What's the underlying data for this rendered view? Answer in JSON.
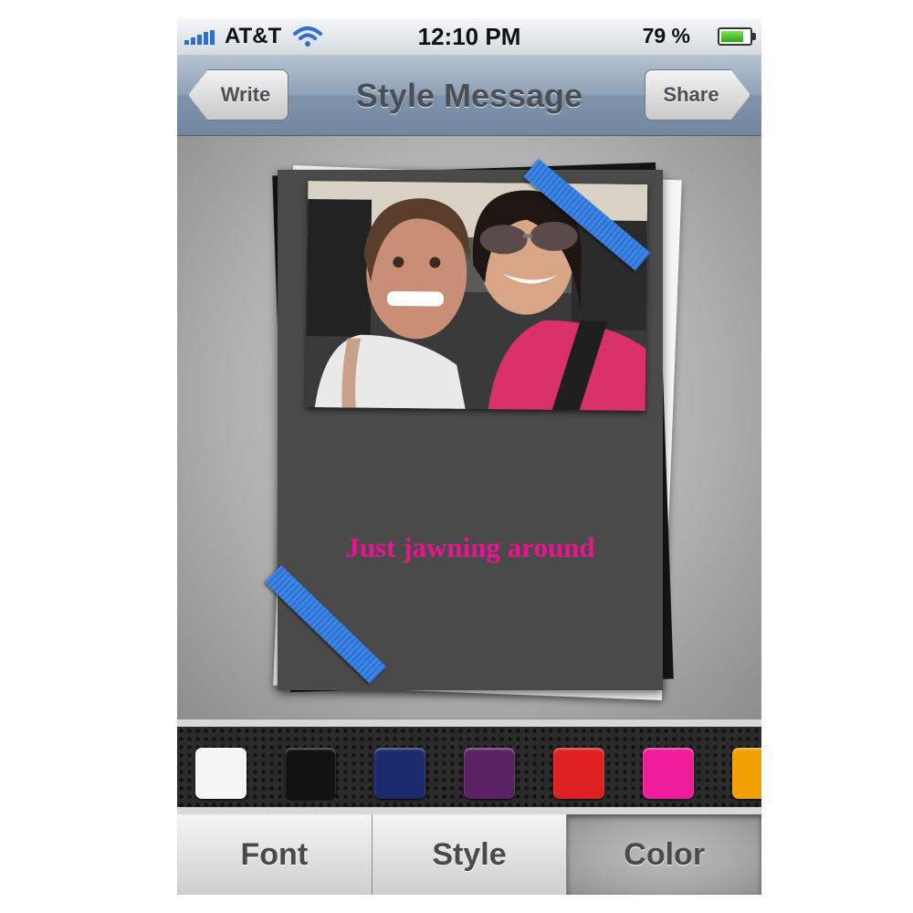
{
  "status_bar": {
    "carrier": "AT&T",
    "time": "12:10 PM",
    "battery_percent": "79 %",
    "battery_level": 0.79,
    "icons": [
      "signal-icon",
      "wifi-icon",
      "battery-icon"
    ]
  },
  "nav": {
    "title": "Style Message",
    "back_label": "Write",
    "share_label": "Share"
  },
  "card": {
    "message": "Just jawning around",
    "message_color": "#e8158f",
    "background_color": "#4a4a4a",
    "ribbon_color": "#3e86e4"
  },
  "colors": [
    {
      "name": "white",
      "hex": "#f5f5f5"
    },
    {
      "name": "black",
      "hex": "#111111"
    },
    {
      "name": "navy",
      "hex": "#1c2a6e"
    },
    {
      "name": "purple",
      "hex": "#5a2263"
    },
    {
      "name": "red",
      "hex": "#dd2020"
    },
    {
      "name": "pink",
      "hex": "#ee1b9a"
    },
    {
      "name": "orange",
      "hex": "#f0a000"
    }
  ],
  "tabs": {
    "font": "Font",
    "style": "Style",
    "color": "Color",
    "active": "Color"
  }
}
